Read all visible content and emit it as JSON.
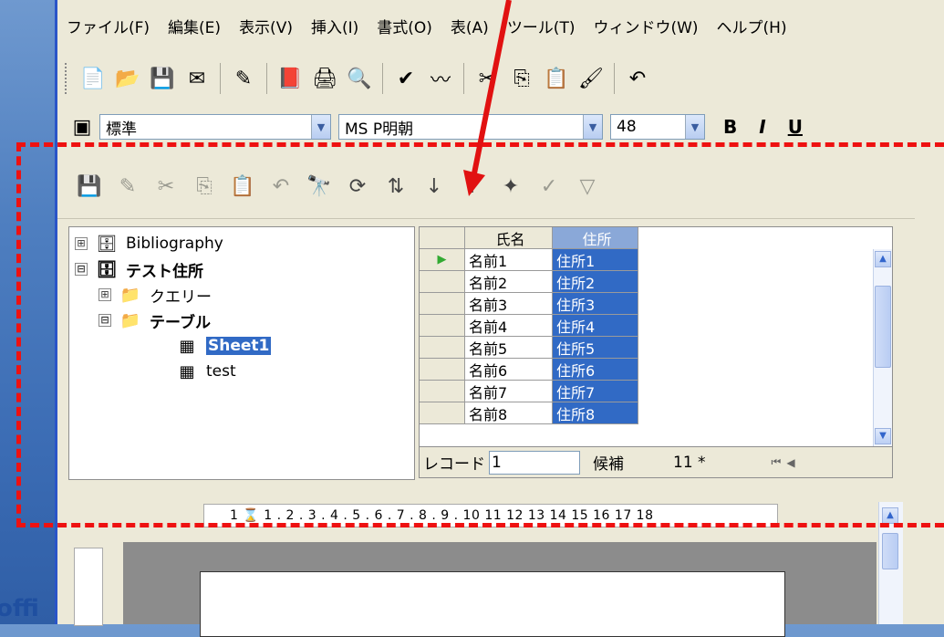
{
  "brand": "offi",
  "menu": [
    "ファイル(F)",
    "編集(E)",
    "表示(V)",
    "挿入(I)",
    "書式(O)",
    "表(A)",
    "ツール(T)",
    "ウィンドウ(W)",
    "ヘルプ(H)"
  ],
  "format_bar": {
    "style": "標準",
    "font": "MS P明朝",
    "size": "48",
    "bold": "B",
    "italic": "I",
    "underline": "U"
  },
  "tree": {
    "items": [
      "Bibliography",
      "テスト住所",
      "クエリー",
      "テーブル",
      "Sheet1",
      "test"
    ],
    "expanders": [
      "⊞",
      "⊟",
      "⊞",
      "⊟"
    ]
  },
  "grid": {
    "headers": [
      "氏名",
      "住所"
    ],
    "rows": [
      [
        "名前1",
        "住所1"
      ],
      [
        "名前2",
        "住所2"
      ],
      [
        "名前3",
        "住所3"
      ],
      [
        "名前4",
        "住所4"
      ],
      [
        "名前5",
        "住所5"
      ],
      [
        "名前6",
        "住所6"
      ],
      [
        "名前7",
        "住所7"
      ],
      [
        "名前8",
        "住所8"
      ]
    ]
  },
  "nav": {
    "label": "レコード",
    "value": "1",
    "candidate_label": "候補",
    "count": "11 *"
  },
  "ruler_text": "1 ⌛ 1 . 2 . 3 . 4 . 5 . 6 . 7 . 8 . 9 . 10 11 12 13 14 15 16 17 18",
  "colors": {
    "annotation": "#e11111",
    "selection": "#316ac5"
  }
}
